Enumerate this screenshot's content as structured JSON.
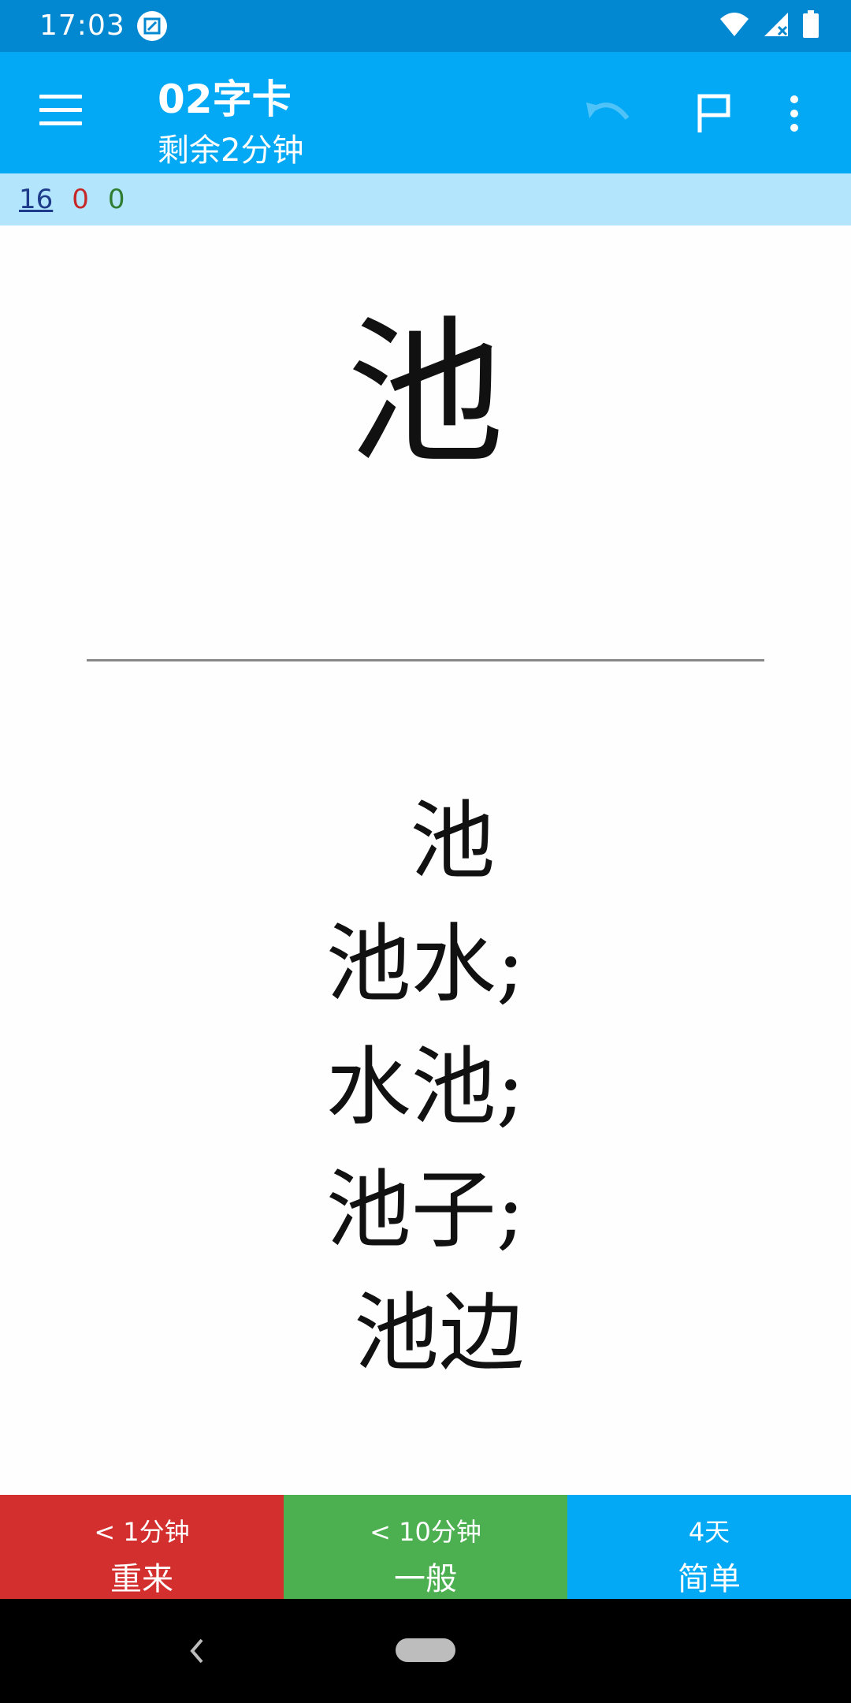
{
  "status_bar": {
    "time": "17:03",
    "icons": [
      "screenshot-app-icon",
      "wifi-icon",
      "signal-icon",
      "battery-icon"
    ]
  },
  "app_bar": {
    "title": "02字卡",
    "subtitle": "剩余2分钟",
    "actions": [
      "menu-icon",
      "undo-icon",
      "flag-icon",
      "more-vert-icon"
    ]
  },
  "counts": {
    "new": "16",
    "learning": "0",
    "review": "0"
  },
  "card": {
    "front": "池",
    "back_lines": [
      "  池",
      "池水;",
      "水池;",
      "池子;",
      " 池边"
    ]
  },
  "answer_buttons": [
    {
      "interval": "< 1分钟",
      "label": "重来"
    },
    {
      "interval": "< 10分钟",
      "label": "一般"
    },
    {
      "interval": "4天",
      "label": "简单"
    }
  ],
  "colors": {
    "status_bar": "#0288d1",
    "app_bar": "#03a9f4",
    "counts_bar": "#b3e5fc",
    "again": "#d32f2f",
    "good": "#4caf50",
    "easy": "#03a9f4"
  }
}
